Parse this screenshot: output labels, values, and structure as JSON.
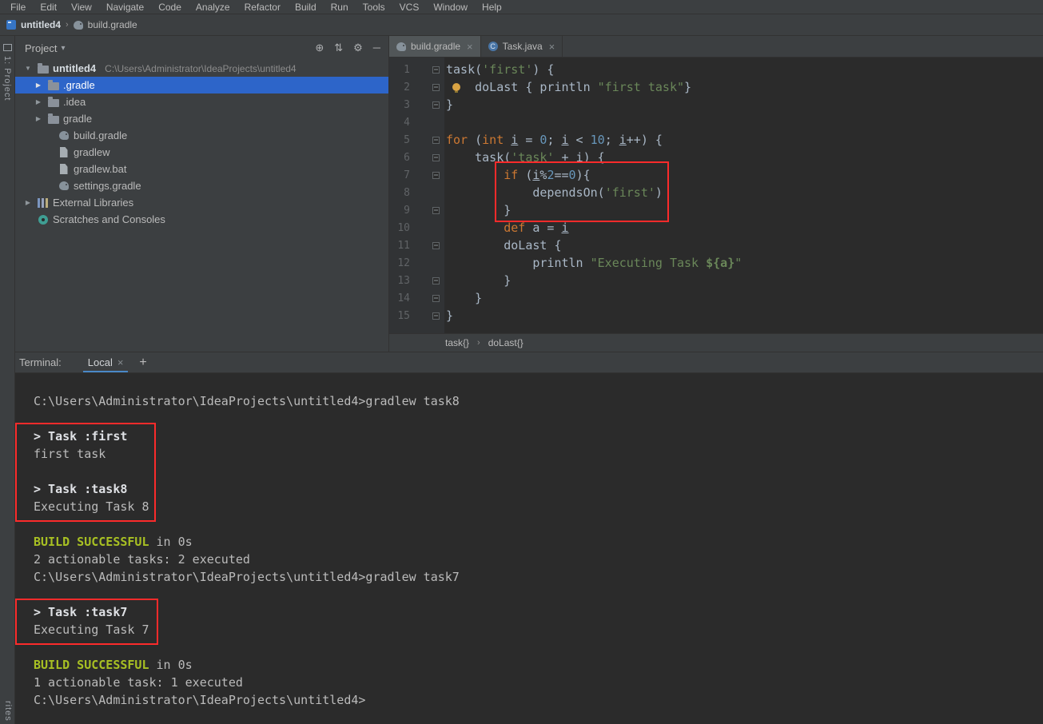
{
  "menu_bar": {
    "items": [
      "File",
      "Edit",
      "View",
      "Navigate",
      "Code",
      "Analyze",
      "Refactor",
      "Build",
      "Run",
      "Tools",
      "VCS",
      "Window",
      "Help"
    ]
  },
  "nav_bar": {
    "project": "untitled4",
    "file": "build.gradle"
  },
  "tool_stripe": {
    "top": "1: Project",
    "bottom": "rites"
  },
  "icons": {
    "dropdown": "▾",
    "chevron": "›",
    "close": "×",
    "plus": "+",
    "locate": "⊕",
    "collapse": "⇅",
    "settings": "⚙",
    "hide": "─",
    "arrow_collapsed": "▶",
    "arrow_expanded": "▼"
  },
  "project_panel": {
    "title": "Project",
    "rows": [
      {
        "label": "untitled4",
        "suffix": "C:\\Users\\Administrator\\IdeaProjects\\untitled4",
        "icon": "folder",
        "arrow": "expanded",
        "indent": 0,
        "selected": false,
        "bold": true
      },
      {
        "label": ".gradle",
        "suffix": "",
        "icon": "folder",
        "arrow": "collapsed",
        "indent": 1,
        "selected": true,
        "bold": false
      },
      {
        "label": ".idea",
        "suffix": "",
        "icon": "folder",
        "arrow": "collapsed",
        "indent": 1,
        "selected": false,
        "bold": false
      },
      {
        "label": "gradle",
        "suffix": "",
        "icon": "folder",
        "arrow": "collapsed",
        "indent": 1,
        "selected": false,
        "bold": false
      },
      {
        "label": "build.gradle",
        "suffix": "",
        "icon": "gradle",
        "arrow": null,
        "indent": 2,
        "selected": false,
        "bold": false
      },
      {
        "label": "gradlew",
        "suffix": "",
        "icon": "file",
        "arrow": null,
        "indent": 2,
        "selected": false,
        "bold": false
      },
      {
        "label": "gradlew.bat",
        "suffix": "",
        "icon": "file",
        "arrow": null,
        "indent": 2,
        "selected": false,
        "bold": false
      },
      {
        "label": "settings.gradle",
        "suffix": "",
        "icon": "gradle",
        "arrow": null,
        "indent": 2,
        "selected": false,
        "bold": false
      },
      {
        "label": "External Libraries",
        "suffix": "",
        "icon": "libraries",
        "arrow": "collapsed",
        "indent": 0,
        "selected": false,
        "bold": false
      },
      {
        "label": "Scratches and Consoles",
        "suffix": "",
        "icon": "scratches",
        "arrow": null,
        "indent": 0,
        "selected": false,
        "bold": false
      }
    ]
  },
  "editor": {
    "tabs": [
      {
        "label": "build.gradle",
        "icon": "gradle",
        "active": true
      },
      {
        "label": "Task.java",
        "icon": "java",
        "active": false
      }
    ],
    "breadcrumbs": [
      "task{}",
      "doLast{}"
    ],
    "lines": [
      {
        "num": "1",
        "fold": "open",
        "tokens": [
          {
            "t": "task(",
            "c": "p"
          },
          {
            "t": "'first'",
            "c": "s"
          },
          {
            "t": ") {",
            "c": "p"
          }
        ]
      },
      {
        "num": "2",
        "fold": "open",
        "bulb": true,
        "tokens": [
          {
            "t": "    doLast { println ",
            "c": "p"
          },
          {
            "t": "\"first task\"",
            "c": "s"
          },
          {
            "t": "}",
            "c": "p"
          }
        ]
      },
      {
        "num": "3",
        "fold": "close",
        "tokens": [
          {
            "t": "}",
            "c": "p"
          }
        ]
      },
      {
        "num": "4",
        "fold": null,
        "tokens": []
      },
      {
        "num": "5",
        "fold": "open",
        "tokens": [
          {
            "t": "for ",
            "c": "k"
          },
          {
            "t": "(",
            "c": "p"
          },
          {
            "t": "int ",
            "c": "k"
          },
          {
            "t": "i",
            "c": "u"
          },
          {
            "t": " = ",
            "c": "p"
          },
          {
            "t": "0",
            "c": "n"
          },
          {
            "t": "; ",
            "c": "p"
          },
          {
            "t": "i",
            "c": "u"
          },
          {
            "t": " < ",
            "c": "p"
          },
          {
            "t": "10",
            "c": "n"
          },
          {
            "t": "; ",
            "c": "p"
          },
          {
            "t": "i",
            "c": "u"
          },
          {
            "t": "++) {",
            "c": "p"
          }
        ]
      },
      {
        "num": "6",
        "fold": "open",
        "tokens": [
          {
            "t": "    task(",
            "c": "p"
          },
          {
            "t": "'task'",
            "c": "s"
          },
          {
            "t": " + ",
            "c": "p"
          },
          {
            "t": "i",
            "c": "u"
          },
          {
            "t": ") {",
            "c": "p"
          }
        ]
      },
      {
        "num": "7",
        "fold": "open",
        "tokens": [
          {
            "t": "        ",
            "c": "p"
          },
          {
            "t": "if ",
            "c": "k"
          },
          {
            "t": "(",
            "c": "p"
          },
          {
            "t": "i",
            "c": "u"
          },
          {
            "t": "%",
            "c": "p"
          },
          {
            "t": "2",
            "c": "n"
          },
          {
            "t": "==",
            "c": "p"
          },
          {
            "t": "0",
            "c": "n"
          },
          {
            "t": "){",
            "c": "p"
          }
        ]
      },
      {
        "num": "8",
        "fold": null,
        "tokens": [
          {
            "t": "            dependsOn(",
            "c": "p"
          },
          {
            "t": "'first'",
            "c": "s"
          },
          {
            "t": ")",
            "c": "p"
          }
        ]
      },
      {
        "num": "9",
        "fold": "close",
        "tokens": [
          {
            "t": "        }",
            "c": "p"
          }
        ]
      },
      {
        "num": "10",
        "fold": null,
        "tokens": [
          {
            "t": "        ",
            "c": "p"
          },
          {
            "t": "def ",
            "c": "k"
          },
          {
            "t": "a",
            "c": "p"
          },
          {
            "t": " = ",
            "c": "p"
          },
          {
            "t": "i",
            "c": "u"
          }
        ]
      },
      {
        "num": "11",
        "fold": "open",
        "tokens": [
          {
            "t": "        doLast {",
            "c": "p"
          }
        ]
      },
      {
        "num": "12",
        "fold": null,
        "tokens": [
          {
            "t": "            println ",
            "c": "p"
          },
          {
            "t": "\"Executing Task ",
            "c": "s"
          },
          {
            "t": "${a}",
            "c": "gv"
          },
          {
            "t": "\"",
            "c": "s"
          }
        ]
      },
      {
        "num": "13",
        "fold": "close",
        "tokens": [
          {
            "t": "        }",
            "c": "p"
          }
        ]
      },
      {
        "num": "14",
        "fold": "close",
        "tokens": [
          {
            "t": "    }",
            "c": "p"
          }
        ]
      },
      {
        "num": "15",
        "fold": "close",
        "tokens": [
          {
            "t": "}",
            "c": "p"
          }
        ]
      }
    ]
  },
  "terminal": {
    "label": "Terminal:",
    "tab_label": "Local",
    "lines": [
      {
        "segs": [
          {
            "t": "C:\\Users\\Administrator\\IdeaProjects\\untitled4>gradlew task8",
            "c": "plain"
          }
        ]
      },
      {
        "segs": []
      },
      {
        "segs": [
          {
            "t": "> Task :first",
            "c": "bold"
          }
        ]
      },
      {
        "segs": [
          {
            "t": "first task",
            "c": "plain"
          }
        ]
      },
      {
        "segs": []
      },
      {
        "segs": [
          {
            "t": "> Task :task8",
            "c": "bold"
          }
        ]
      },
      {
        "segs": [
          {
            "t": "Executing Task 8",
            "c": "plain"
          }
        ]
      },
      {
        "segs": []
      },
      {
        "segs": [
          {
            "t": "BUILD SUCCESSFUL",
            "c": "success"
          },
          {
            "t": " in 0s",
            "c": "plain"
          }
        ]
      },
      {
        "segs": [
          {
            "t": "2 actionable tasks: 2 executed",
            "c": "plain"
          }
        ]
      },
      {
        "segs": [
          {
            "t": "C:\\Users\\Administrator\\IdeaProjects\\untitled4>gradlew task7",
            "c": "plain"
          }
        ]
      },
      {
        "segs": []
      },
      {
        "segs": [
          {
            "t": "> Task :task7",
            "c": "bold"
          }
        ]
      },
      {
        "segs": [
          {
            "t": "Executing Task 7",
            "c": "plain"
          }
        ]
      },
      {
        "segs": []
      },
      {
        "segs": [
          {
            "t": "BUILD SUCCESSFUL",
            "c": "success"
          },
          {
            "t": " in 0s",
            "c": "plain"
          }
        ]
      },
      {
        "segs": [
          {
            "t": "1 actionable task: 1 executed",
            "c": "plain"
          }
        ]
      },
      {
        "segs": [
          {
            "t": "C:\\Users\\Administrator\\IdeaProjects\\untitled4>",
            "c": "plain"
          }
        ]
      }
    ]
  },
  "annotations": {
    "color": "#fb2b2b"
  }
}
